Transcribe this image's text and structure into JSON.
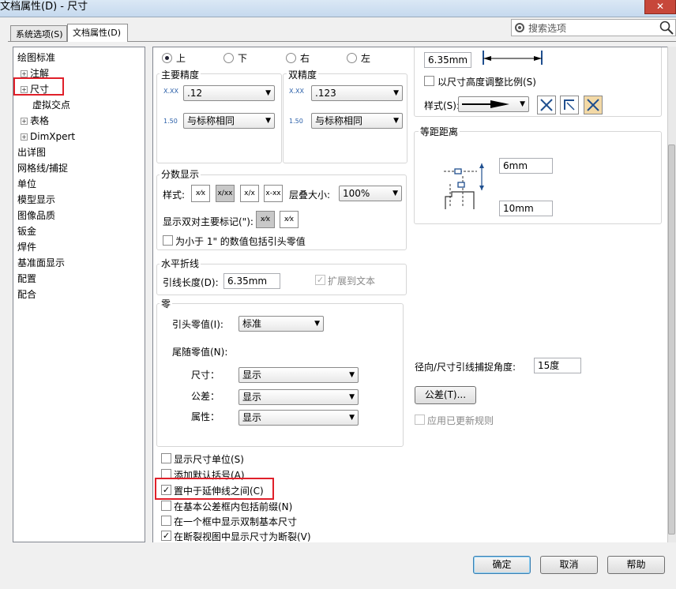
{
  "window": {
    "title": "文档属性(D) - 尺寸",
    "close_glyph": "✕"
  },
  "tabs": [
    {
      "label": "系统选项(S)"
    },
    {
      "label": "文档属性(D)"
    }
  ],
  "search": {
    "label": "搜索选项"
  },
  "tree": [
    {
      "label": "绘图标准",
      "expander": ""
    },
    {
      "label": "注解",
      "expander": "+"
    },
    {
      "label": "尺寸",
      "expander": "+"
    },
    {
      "label": "虚拟交点",
      "expander": ""
    },
    {
      "label": "表格",
      "expander": "+"
    },
    {
      "label": "DimXpert",
      "expander": "+"
    },
    {
      "label": "出详图",
      "expander": ""
    },
    {
      "label": "网格线/捕捉",
      "expander": ""
    },
    {
      "label": "单位",
      "expander": ""
    },
    {
      "label": "模型显示",
      "expander": ""
    },
    {
      "label": "图像品质",
      "expander": ""
    },
    {
      "label": "钣金",
      "expander": ""
    },
    {
      "label": "焊件",
      "expander": ""
    },
    {
      "label": "基准面显示",
      "expander": ""
    },
    {
      "label": "配置",
      "expander": ""
    },
    {
      "label": "配合",
      "expander": ""
    }
  ],
  "placement": {
    "options": [
      "上",
      "下",
      "右",
      "左"
    ],
    "selected": "上"
  },
  "primary_precision": {
    "title": "主要精度",
    "value": ".12",
    "tolerance": "与标称相同",
    "icon_a": "X.XX",
    "icon_b": "1.50"
  },
  "dual_precision": {
    "title": "双精度",
    "value": ".123",
    "tolerance": "与标称相同",
    "icon_a": "X.XX",
    "icon_b": "1.50"
  },
  "fraction": {
    "title": "分数显示",
    "style_label": "样式:",
    "stack_label": "层叠大小:",
    "stack_value": "100%",
    "dual_label": "显示双对主要标记(\"):",
    "leading_zero_label": "为小于 1\" 的数值包括引头零值",
    "style_icons": [
      "x⁄x",
      "x/xx",
      "x/x",
      "x-xx"
    ]
  },
  "bent_leader": {
    "title": "水平折线",
    "length_label": "引线长度(D):",
    "length_value": "6.35mm",
    "extend_label": "扩展到文本"
  },
  "zeros": {
    "title": "零",
    "leading_label": "引头零值(I):",
    "leading_value": "标准",
    "trailing_label": "尾随零值(N):",
    "rows": [
      {
        "label": "尺寸：",
        "value": "显示"
      },
      {
        "label": "公差：",
        "value": "显示"
      },
      {
        "label": "属性：",
        "value": "显示"
      }
    ]
  },
  "options": [
    {
      "label": "显示尺寸单位(S)",
      "checked": false
    },
    {
      "label": "添加默认括号(A)",
      "checked": false
    },
    {
      "label": "置中于延伸线之间(C)",
      "checked": true
    },
    {
      "label": "在基本公差框内包括前缀(N)",
      "checked": false
    },
    {
      "label": "在一个框中显示双制基本尺寸",
      "checked": false
    },
    {
      "label": "在断裂视图中显示尺寸为断裂(V)",
      "checked": true
    }
  ],
  "arrows": {
    "value": "6.35mm",
    "scale_label": "以尺寸高度调整比例(S)",
    "style_label": "样式(S):"
  },
  "offset": {
    "title": "等距距离",
    "v1": "6mm",
    "v2": "10mm"
  },
  "snap": {
    "label": "径向/尺寸引线捕捉角度:",
    "value": "15度"
  },
  "tolerance_button": "公差(T)...",
  "apply_updated_label": "应用已更新规则",
  "footer": {
    "ok": "确定",
    "cancel": "取消",
    "help": "帮助"
  },
  "check_glyph": "✓",
  "colors": {
    "highlight": "#e0202a"
  }
}
